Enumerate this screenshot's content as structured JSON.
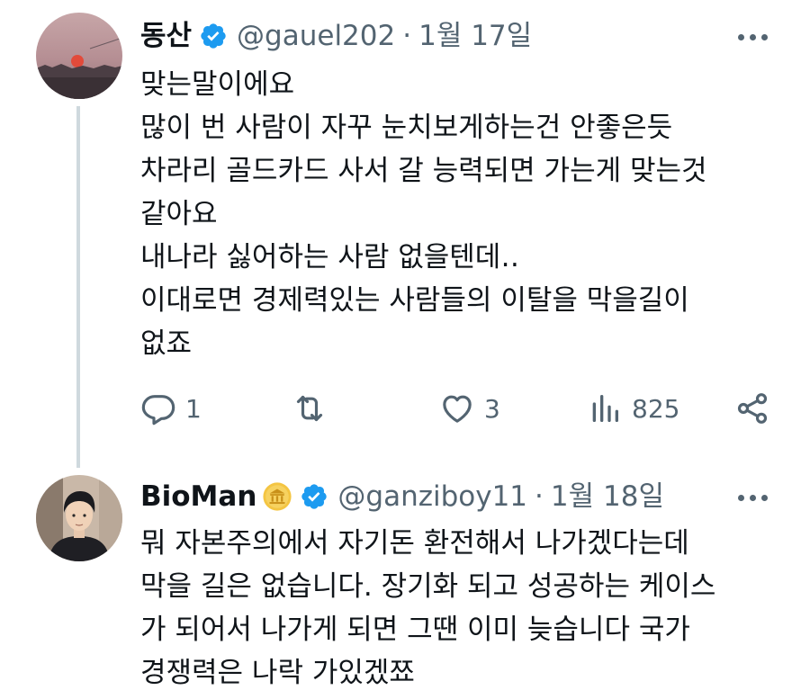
{
  "tweets": [
    {
      "author": {
        "name": "동산",
        "handle": "@gauel202",
        "verified": true,
        "avatar": "sunset-landscape-avatar"
      },
      "separator": "·",
      "date": "1월 17일",
      "lines": [
        "맞는말이에요",
        "많이 번 사람이 자꾸 눈치보게하는건 안좋은듯",
        "차라리 골드카드 사서 갈 능력되면 가는게 맞는것",
        "같아요",
        "내나라 싫어하는 사람 없을텐데‥",
        "이대로면 경제력있는 사람들의 이탈을 막을길이",
        "없죠"
      ],
      "stats": {
        "replies": "1",
        "reposts": "",
        "likes": "3",
        "views": "825"
      }
    },
    {
      "author": {
        "name": "BioMan",
        "handle": "@ganziboy11",
        "verified": true,
        "badge": "gold-building-icon",
        "avatar": "man-portrait-avatar"
      },
      "separator": "·",
      "date": "1월 18일",
      "lines": [
        "뭐 자본주의에서 자기돈 환전해서 나가겠다는데",
        "막을 길은 없습니다. 장기화 되고 성공하는 케이스",
        "가 되어서 나가게 되면 그땐 이미 늦습니다 국가",
        "경쟁력은 나락 가있겠쬬"
      ]
    }
  ],
  "colors": {
    "text_primary": "#0f1419",
    "text_secondary": "#536471",
    "verified_blue": "#1d9bf0",
    "thread_line": "#cfd9de",
    "gold_badge": "#f4c542"
  }
}
